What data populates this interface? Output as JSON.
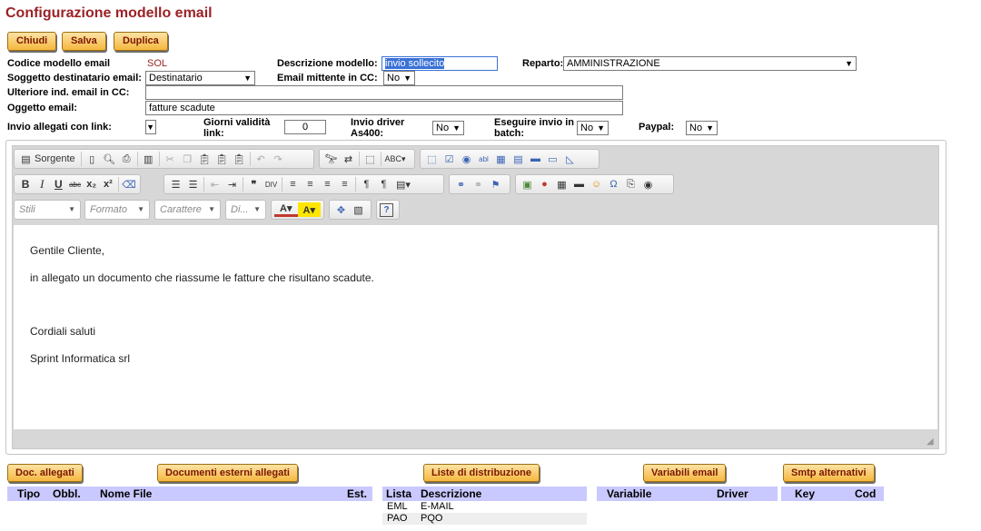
{
  "page": {
    "title": "Configurazione modello email"
  },
  "actions": {
    "close": "Chiudi",
    "save": "Salva",
    "duplicate": "Duplica"
  },
  "form": {
    "code_label": "Codice modello email",
    "code_value": "SOL",
    "description_label": "Descrizione modello:",
    "description_value": "invio sollecito",
    "department_label": "Reparto:",
    "department_value": "AMMINISTRAZIONE",
    "recipient_label": "Soggetto destinatario email:",
    "recipient_value": "Destinatario",
    "sender_cc_label": "Email mittente in CC:",
    "sender_cc_value": "No",
    "extra_cc_label": "Ulteriore ind. email in CC:",
    "extra_cc_value": "",
    "subject_label": "Oggetto email:",
    "subject_value": "fatture scadute",
    "attach_link_label": "Invio allegati con link:",
    "validity_label_1": "Giorni validità",
    "validity_label_2": "link:",
    "validity_value": "0",
    "driver_label_1": "Invio driver",
    "driver_label_2": "As400:",
    "driver_value": "No",
    "batch_label_1": "Eseguire invio in",
    "batch_label_2": "batch:",
    "batch_value": "No",
    "paypal_label": "Paypal:",
    "paypal_value": "No"
  },
  "editor": {
    "source_label": "Sorgente",
    "styles_label": "Stili",
    "format_label": "Formato",
    "font_label": "Carattere",
    "size_label": "Di...",
    "body": {
      "greeting": "Gentile Cliente,",
      "line1": "in allegato un documento che riassume le fatture che risultano scadute.",
      "closing": "Cordiali saluti",
      "signature": "Sprint Informatica srl"
    }
  },
  "sections": {
    "attachments_button": "Doc. allegati",
    "external_docs_button": "Documenti esterni allegati",
    "distribution_button": "Liste di distribuzione",
    "variables_button": "Variabili email",
    "smtp_button": "Smtp alternativi",
    "attachments_headers": [
      "Tipo",
      "Obbl.",
      "Nome File",
      "Est."
    ],
    "distribution_headers": [
      "Lista",
      "Descrizione"
    ],
    "distribution_rows": [
      {
        "lista": "EML",
        "descrizione": "E-MAIL"
      },
      {
        "lista": "PAO",
        "descrizione": "PQO"
      }
    ],
    "variables_headers": [
      "Variabile",
      "Driver"
    ],
    "smtp_headers": [
      "Key",
      "Cod"
    ]
  }
}
